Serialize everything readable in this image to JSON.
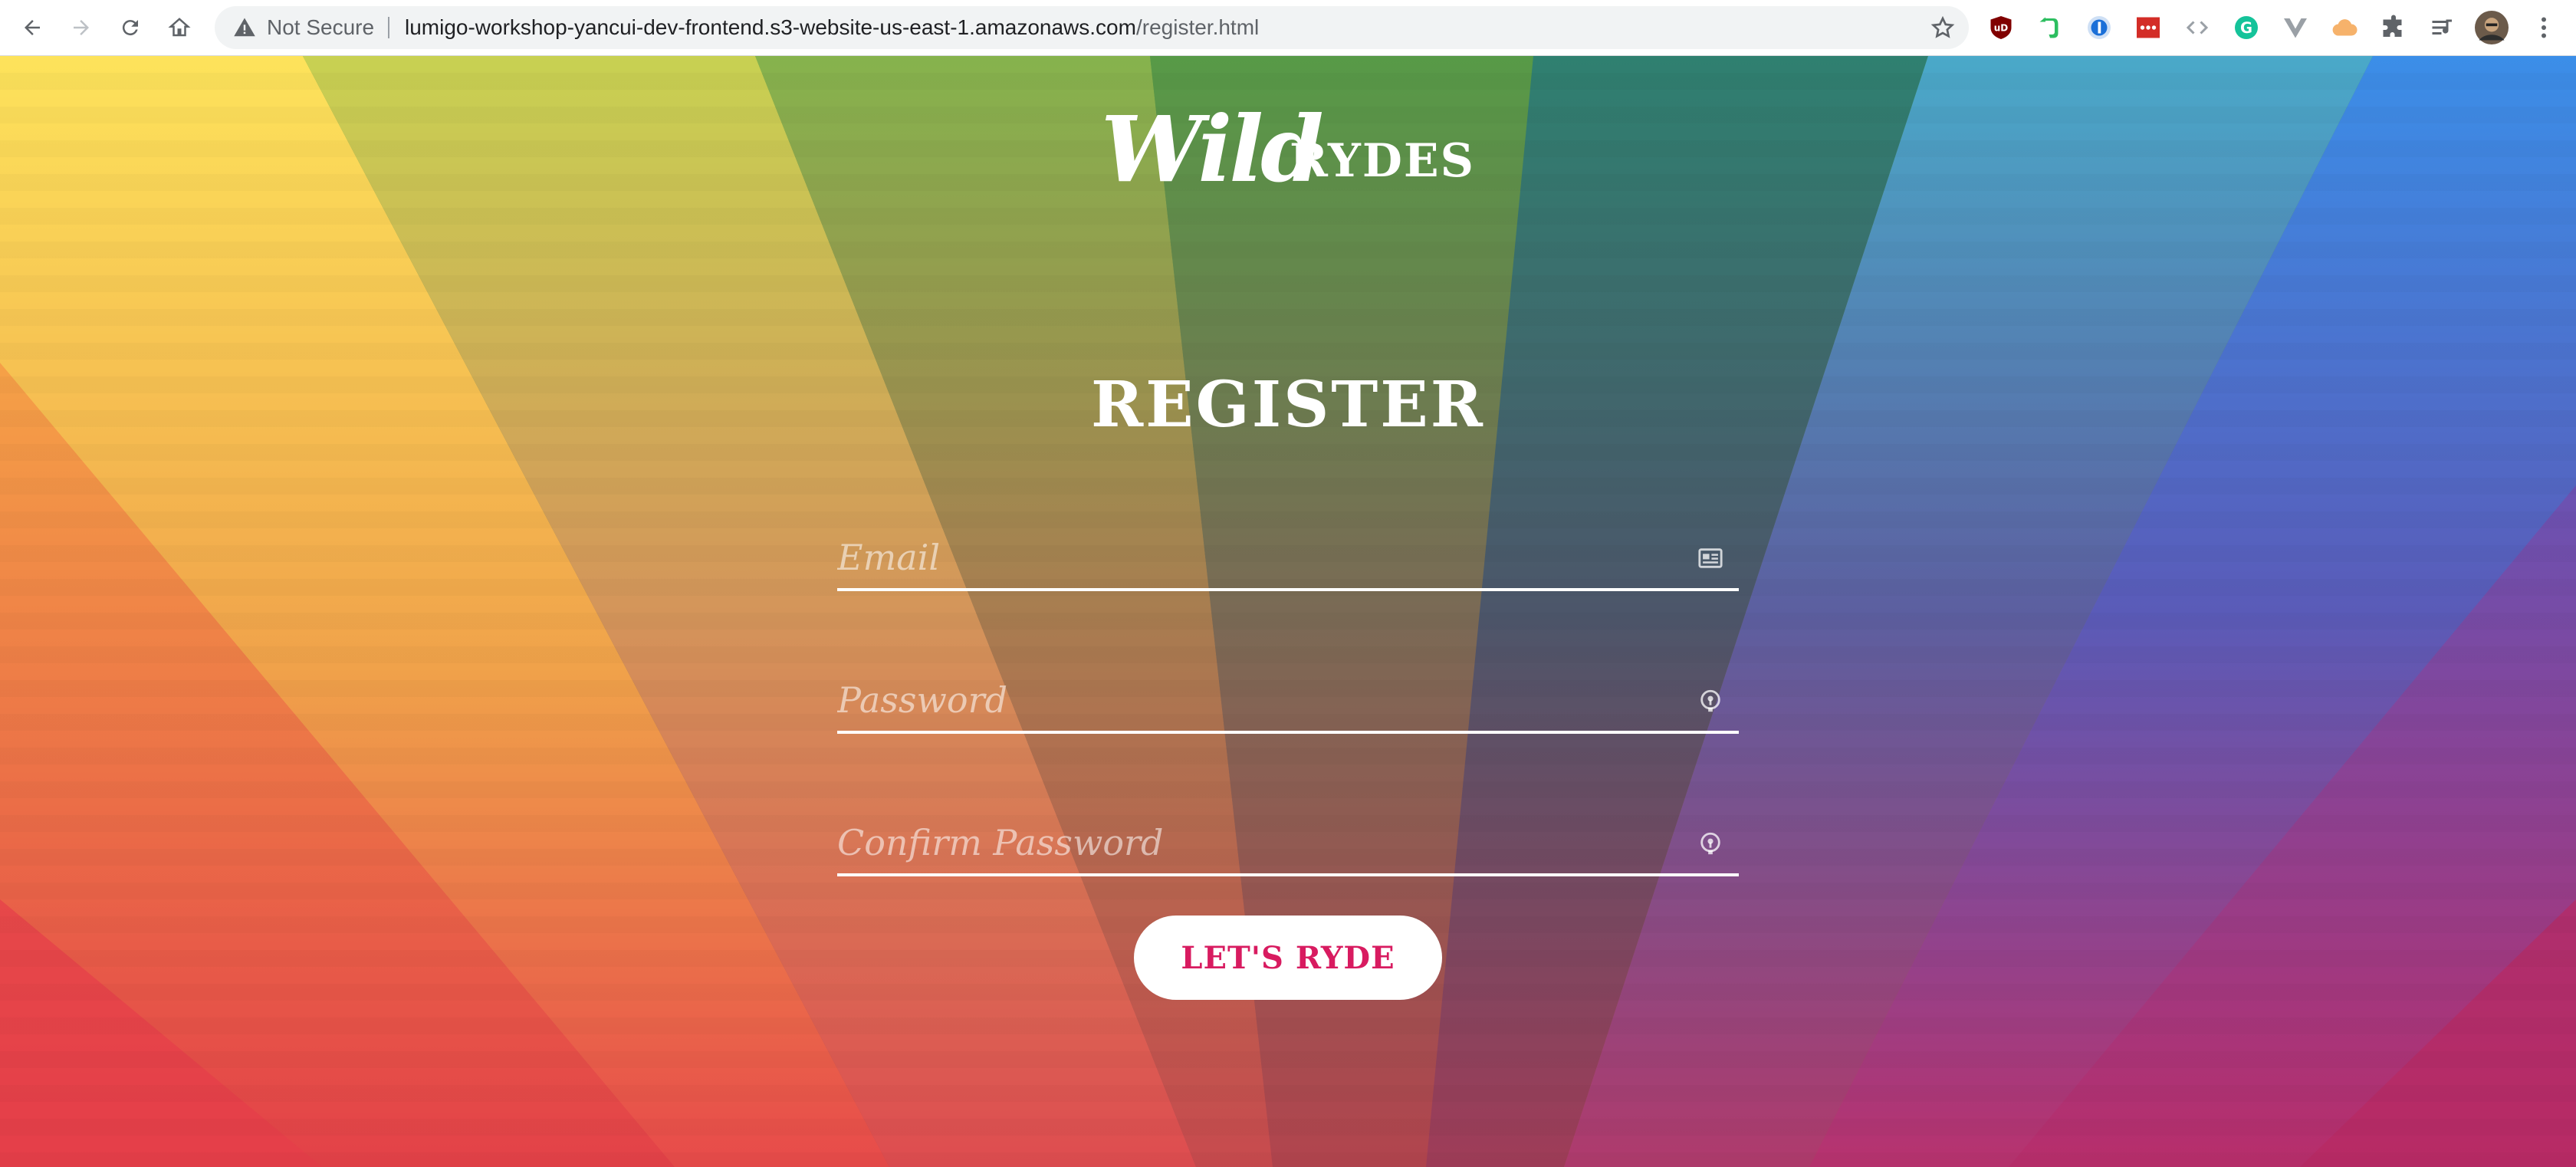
{
  "browser": {
    "security_label": "Not Secure",
    "url_host": "lumigo-workshop-yancui-dev-frontend.s3-website-us-east-1.amazonaws.com",
    "url_path": "/register.html",
    "extensions": [
      "ublock-origin-icon",
      "evernote-icon",
      "1password-icon",
      "lastpass-icon",
      "code-brackets-icon",
      "grammarly-icon",
      "vue-devtools-icon",
      "cloud-icon",
      "puzzle-extensions-icon",
      "media-playlist-icon",
      "profile-avatar",
      "more-menu-icon"
    ]
  },
  "brand": {
    "logo_script": "Wild",
    "logo_caps": "RYDES"
  },
  "form": {
    "title": "REGISTER",
    "email_placeholder": "Email",
    "password_placeholder": "Password",
    "confirm_placeholder": "Confirm Password",
    "submit_label": "LET'S RYDE"
  },
  "colors": {
    "accent": "#d81b60",
    "field_line": "#ffffff",
    "chrome_bg": "#ffffff",
    "omnibox_bg": "#f1f3f4"
  }
}
